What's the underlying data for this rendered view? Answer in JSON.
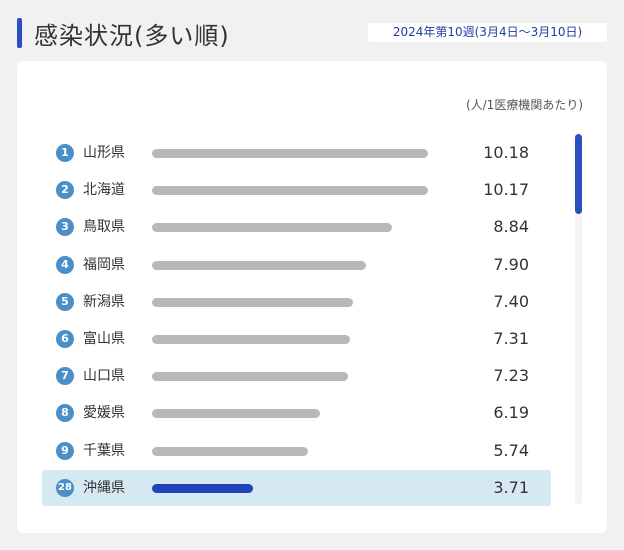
{
  "header": {
    "title": "感染状況(多い順)",
    "week": "2024年第10週(3月4日〜3月10日)",
    "accent_color": "#2a4fbf"
  },
  "unit": "(人/1医療機関あたり)",
  "bar_max": 10.18,
  "rows": [
    {
      "rank": "1",
      "prefecture": "山形県",
      "value": "10.18",
      "num": 10.18,
      "highlight": false
    },
    {
      "rank": "2",
      "prefecture": "北海道",
      "value": "10.17",
      "num": 10.17,
      "highlight": false
    },
    {
      "rank": "3",
      "prefecture": "鳥取県",
      "value": "8.84",
      "num": 8.84,
      "highlight": false
    },
    {
      "rank": "4",
      "prefecture": "福岡県",
      "value": "7.90",
      "num": 7.9,
      "highlight": false
    },
    {
      "rank": "5",
      "prefecture": "新潟県",
      "value": "7.40",
      "num": 7.4,
      "highlight": false
    },
    {
      "rank": "6",
      "prefecture": "富山県",
      "value": "7.31",
      "num": 7.31,
      "highlight": false
    },
    {
      "rank": "7",
      "prefecture": "山口県",
      "value": "7.23",
      "num": 7.23,
      "highlight": false
    },
    {
      "rank": "8",
      "prefecture": "愛媛県",
      "value": "6.19",
      "num": 6.19,
      "highlight": false
    },
    {
      "rank": "9",
      "prefecture": "千葉県",
      "value": "5.74",
      "num": 5.74,
      "highlight": false
    },
    {
      "rank": "28",
      "prefecture": "沖縄県",
      "value": "3.71",
      "num": 3.71,
      "highlight": true
    }
  ],
  "colors": {
    "bar": "#b8b8b8",
    "bar_highlight": "#1e45b8",
    "rank_badge": "#4b8fc8",
    "highlight_row": "#d6e8f1"
  }
}
